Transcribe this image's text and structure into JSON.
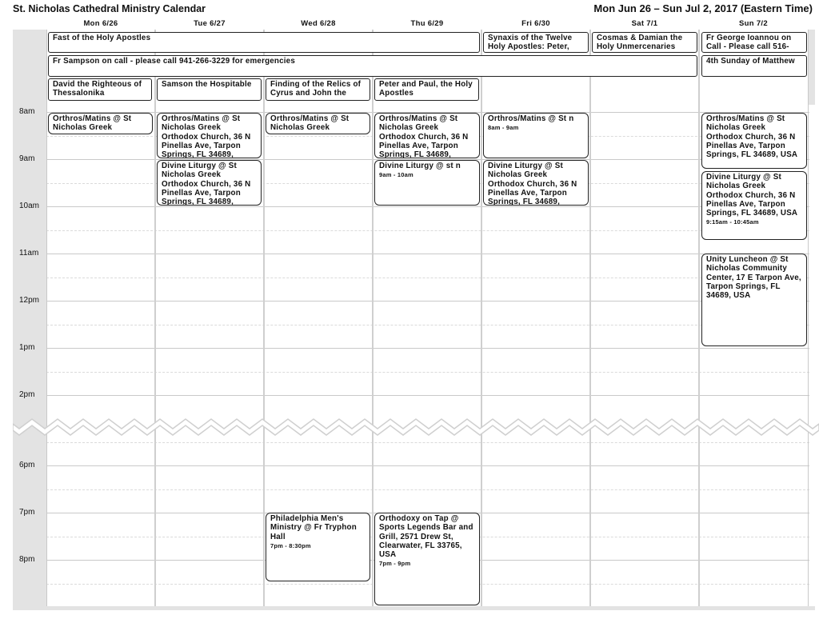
{
  "calendar": {
    "title": "St. Nicholas Cathedral Ministry Calendar",
    "range": "Mon Jun 26 – Sun Jul 2, 2017 (Eastern Time)"
  },
  "days": [
    "Mon 6/26",
    "Tue 6/27",
    "Wed 6/28",
    "Thu 6/29",
    "Fri 6/30",
    "Sat 7/1",
    "Sun 7/2"
  ],
  "times": [
    "8am",
    "9am",
    "10am",
    "11am",
    "12pm",
    "1pm",
    "2pm",
    "6pm",
    "7pm",
    "8pm"
  ],
  "all_day": [
    "Fast of the Holy Apostles",
    "Synaxis of the Twelve Holy Apostles: Peter, Andrew, James, John",
    "Cosmas & Damian the Holy Unmercenaries",
    "Fr George Ioannou on Call - Please call 516-",
    "Fr Sampson on call - please call 941-266-3229 for emergencies",
    "4th Sunday of Matthew",
    "David the Righteous of Thessalonika",
    "Samson the Hospitable",
    "Finding of the Relics of Cyrus and John the",
    "Peter and Paul, the Holy Apostles"
  ],
  "events": [
    {
      "title": "Orthros/Matins @ St Nicholas Greek",
      "time": ""
    },
    {
      "title": "Orthros/Matins @ St Nicholas Greek Orthodox Church, 36 N Pinellas Ave, Tarpon Springs, FL 34689,",
      "time": ""
    },
    {
      "title": "Orthros/Matins @ St Nicholas Greek",
      "time": ""
    },
    {
      "title": "Orthros/Matins @ St Nicholas Greek Orthodox Church, 36 N Pinellas Ave, Tarpon Springs, FL 34689,",
      "time": ""
    },
    {
      "title": "Orthros/Matins @ St n",
      "time": "8am - 9am"
    },
    {
      "title": "Orthros/Matins @ St Nicholas Greek Orthodox Church, 36 N Pinellas Ave, Tarpon Springs, FL 34689, USA",
      "time": ""
    },
    {
      "title": "Divine Liturgy @ St Nicholas Greek Orthodox Church, 36 N Pinellas Ave, Tarpon Springs, FL 34689,",
      "time": ""
    },
    {
      "title": "Divine Liturgy @ st n",
      "time": "9am - 10am"
    },
    {
      "title": "Divine Liturgy @ St Nicholas Greek Orthodox Church, 36 N Pinellas Ave, Tarpon Springs, FL 34689,",
      "time": ""
    },
    {
      "title": "Divine Liturgy @ St Nicholas Greek Orthodox Church, 36 N Pinellas Ave, Tarpon Springs, FL 34689, USA",
      "time": "9:15am - 10:45am"
    },
    {
      "title": "Unity Luncheon @ St Nicholas Community Center, 17 E Tarpon Ave, Tarpon Springs, FL 34689, USA",
      "time": ""
    },
    {
      "title": "Philadelphia Men's Ministry @ Fr Tryphon Hall",
      "time": "7pm - 8:30pm"
    },
    {
      "title": "Orthodoxy on Tap @ Sports Legends Bar and Grill, 2571 Drew St, Clearwater, FL 33765, USA",
      "time": "7pm - 9pm"
    }
  ]
}
